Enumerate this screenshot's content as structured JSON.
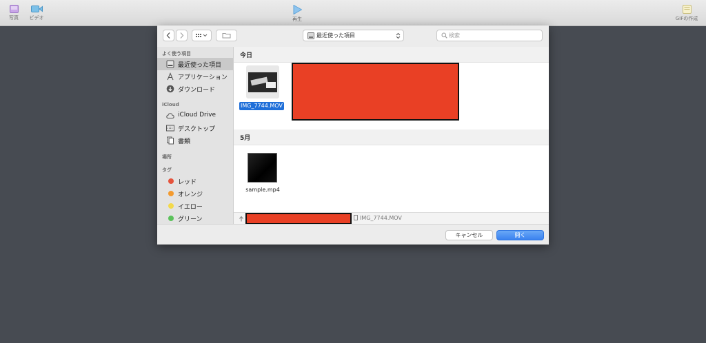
{
  "app_toolbar": {
    "photo_label": "写真",
    "video_label": "ビデオ",
    "play_label": "再生",
    "gif_label": "GIFの作成"
  },
  "dialog": {
    "location": "最近使った項目",
    "search_placeholder": "検索",
    "sidebar": {
      "favorites_header": "よく使う項目",
      "favorites": [
        {
          "label": "最近使った項目",
          "icon": "recent-icon"
        },
        {
          "label": "アプリケーション",
          "icon": "applications-icon"
        },
        {
          "label": "ダウンロード",
          "icon": "download-icon"
        }
      ],
      "icloud_header": "iCloud",
      "icloud": [
        {
          "label": "iCloud Drive",
          "icon": "cloud-icon"
        },
        {
          "label": "デスクトップ",
          "icon": "desktop-icon"
        },
        {
          "label": "書類",
          "icon": "documents-icon"
        }
      ],
      "places_header": "場所",
      "tags_header": "タグ",
      "tags": [
        {
          "label": "レッド",
          "color": "#e5533c"
        },
        {
          "label": "オレンジ",
          "color": "#f39a2e"
        },
        {
          "label": "イエロー",
          "color": "#f3d94b"
        },
        {
          "label": "グリーン",
          "color": "#5bc25b"
        }
      ]
    },
    "sections": [
      {
        "title": "今日",
        "files": [
          {
            "name": "IMG_7744.MOV",
            "selected": true
          }
        ]
      },
      {
        "title": "5月",
        "files": [
          {
            "name": "sample.mp4",
            "selected": false
          }
        ]
      }
    ],
    "path_file": "IMG_7744.MOV",
    "cancel_label": "キャンセル",
    "open_label": "開く",
    "redaction_color": "#e94025"
  }
}
